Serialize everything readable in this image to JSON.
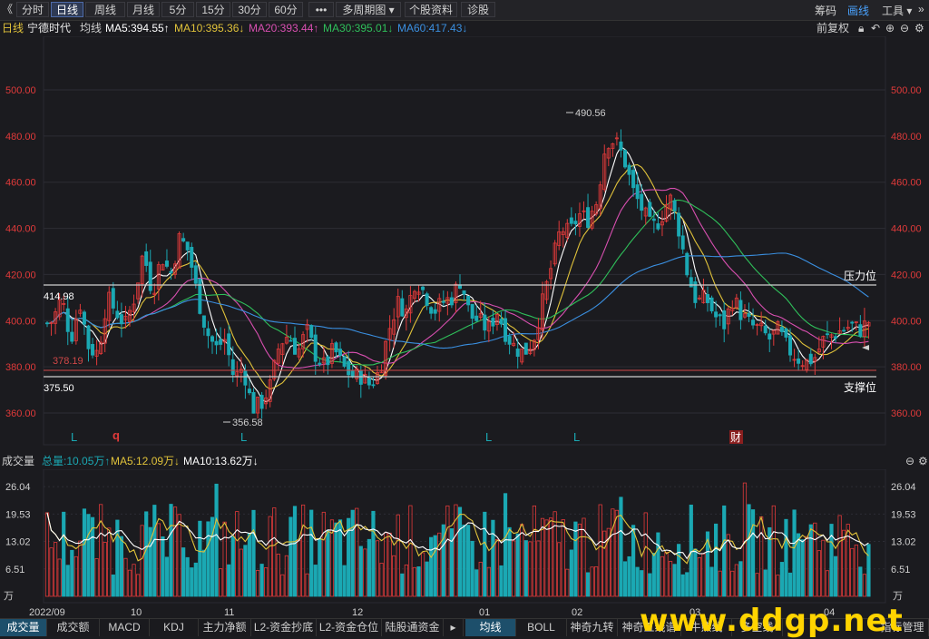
{
  "toolbar": {
    "back": "《",
    "tabs": [
      {
        "label": "分时",
        "active": false
      },
      {
        "label": "日线",
        "active": true
      },
      {
        "label": "周线",
        "active": false
      },
      {
        "label": "月线",
        "active": false
      },
      {
        "label": "5分",
        "active": false
      },
      {
        "label": "15分",
        "active": false
      },
      {
        "label": "30分",
        "active": false
      },
      {
        "label": "60分",
        "active": false
      },
      {
        "label": "•••",
        "active": false
      },
      {
        "label": "多周期图 ▾",
        "active": false
      },
      {
        "label": "个股资料",
        "active": false
      },
      {
        "label": "诊股",
        "active": false
      }
    ],
    "right": {
      "chips": "筹码",
      "draw": "画线",
      "tools": "工具 ▾",
      "more": "»"
    }
  },
  "info": {
    "period": "日线",
    "name": "宁德时代",
    "avg": "均线",
    "ma5": "MA5:394.55↑",
    "ma10": "MA10:395.36↓",
    "ma20": "MA20:393.44↑",
    "ma30": "MA30:395.01↓",
    "ma60": "MA60:417.43↓",
    "adjust": "前复权"
  },
  "colors": {
    "up": "#e03a3a",
    "down": "#1ba8b3",
    "ma5": "#ffffff",
    "ma10": "#e0c23a",
    "ma20": "#d84fb0",
    "ma30": "#2fbf5a",
    "ma60": "#3a8fe0",
    "bg": "#1b1b1f",
    "grid": "#2c2c34"
  },
  "chart_data": {
    "type": "candlestick",
    "price_axis": {
      "ticks": [
        "500.00",
        "480.00",
        "460.00",
        "440.00",
        "420.00",
        "400.00",
        "380.00",
        "360.00"
      ],
      "ylim": [
        352,
        518
      ]
    },
    "annotations": {
      "high_label": "490.56",
      "low_label": "356.58",
      "level_left_1": "414.98",
      "level_left_2": "378.19",
      "level_left_3": "375.50",
      "resistance": "压力位",
      "support": "支撑位"
    },
    "markers": [
      "L",
      "q",
      "L",
      "L",
      "L",
      "财"
    ],
    "x_labels": [
      "2022/09",
      "10",
      "11",
      "12",
      "01",
      "02",
      "03",
      "04"
    ],
    "volume": {
      "title": "成交量",
      "total": "总量:10.05万↑",
      "ma5": "MA5:12.09万↓",
      "ma10": "MA10:13.62万↓",
      "ticks": [
        "26.04",
        "19.53",
        "13.02",
        "6.51"
      ],
      "unit": "万",
      "ylim": [
        0,
        28
      ]
    }
  },
  "bottom_tabs": [
    {
      "label": "成交量",
      "active": true
    },
    {
      "label": "成交额",
      "active": false
    },
    {
      "label": "MACD",
      "active": false
    },
    {
      "label": "KDJ",
      "active": false
    },
    {
      "label": "主力净额",
      "active": false
    },
    {
      "label": "L2-资金抄底",
      "active": false
    },
    {
      "label": "L2-资金仓位",
      "active": false
    },
    {
      "label": "陆股通资金",
      "active": false
    },
    {
      "label": "▸",
      "active": false
    },
    {
      "label": "均线",
      "active": true
    },
    {
      "label": "BOLL",
      "active": false
    },
    {
      "label": "神奇九转",
      "active": false
    },
    {
      "label": "神奇五线谱",
      "active": false
    },
    {
      "label": "牛熊线",
      "active": false
    },
    {
      "label": "多空线",
      "active": false
    },
    {
      "label": "指标管理",
      "active": false
    }
  ],
  "watermark": "www.ddgp.net"
}
